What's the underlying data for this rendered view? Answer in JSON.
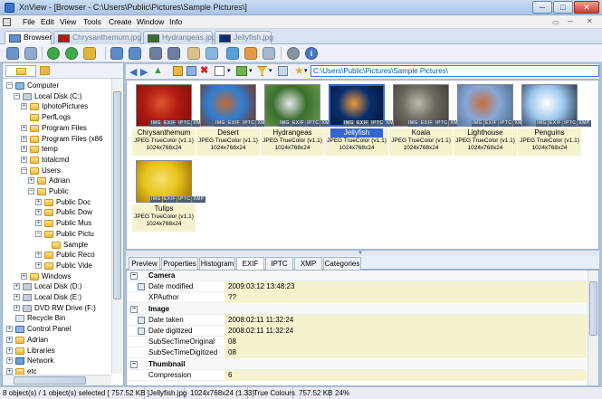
{
  "window": {
    "title": "XnView - [Browser - C:\\Users\\Public\\Pictures\\Sample Pictures\\]",
    "controls": [
      "─",
      "□",
      "✕"
    ]
  },
  "menu": [
    "File",
    "Edit",
    "View",
    "Tools",
    "Create",
    "Window",
    "Info"
  ],
  "tabs": [
    {
      "label": "Browser",
      "active": true
    },
    {
      "label": "Chrysanthemum.jpg",
      "active": false
    },
    {
      "label": "Hydrangeas.jpg",
      "active": false
    },
    {
      "label": "Jellyfish.jpg",
      "active": false
    }
  ],
  "path": "C:\\Users\\Public\\Pictures\\Sample Pictures\\",
  "tree": [
    {
      "label": "Computer",
      "icon": "computer-icon",
      "expander": "−"
    },
    {
      "label": "Local Disk (C:)",
      "icon": "drive-icon",
      "expander": "−"
    },
    {
      "label": "IphotoPictures",
      "icon": "folder-icon",
      "expander": "+"
    },
    {
      "label": "PerfLogs",
      "icon": "folder-icon",
      "expander": ""
    },
    {
      "label": "Program Files",
      "icon": "folder-icon",
      "expander": "+"
    },
    {
      "label": "Program Files (x86",
      "icon": "folder-icon",
      "expander": "+"
    },
    {
      "label": "temp",
      "icon": "folder-icon",
      "expander": "+"
    },
    {
      "label": "totalcmd",
      "icon": "folder-icon",
      "expander": "+"
    },
    {
      "label": "Users",
      "icon": "folder-icon",
      "expander": "−"
    },
    {
      "label": "Adrian",
      "icon": "folder-icon",
      "expander": "+"
    },
    {
      "label": "Public",
      "icon": "folder-icon",
      "expander": "−"
    },
    {
      "label": "Public Doc",
      "icon": "folder-icon",
      "expander": "+"
    },
    {
      "label": "Public Dow",
      "icon": "folder-icon",
      "expander": "+"
    },
    {
      "label": "Public Mus",
      "icon": "folder-icon",
      "expander": "+"
    },
    {
      "label": "Public Pictu",
      "icon": "folder-icon",
      "expander": "−"
    },
    {
      "label": "Sample",
      "icon": "folder-icon",
      "expander": ""
    },
    {
      "label": "Public Reco",
      "icon": "folder-icon",
      "expander": "+"
    },
    {
      "label": "Public Vide",
      "icon": "folder-icon",
      "expander": "+"
    },
    {
      "label": "Windows",
      "icon": "folder-icon",
      "expander": "+"
    },
    {
      "label": "Local Disk (D:)",
      "icon": "drive-icon",
      "expander": "+"
    },
    {
      "label": "Local Disk (E:)",
      "icon": "drive-icon",
      "expander": "+"
    },
    {
      "label": "DVD RW Drive (F:)",
      "icon": "drive-icon",
      "expander": "+"
    },
    {
      "label": "Recycle Bin",
      "icon": "bin-icon",
      "expander": ""
    },
    {
      "label": "Control Panel",
      "icon": "computer-icon",
      "expander": "+"
    },
    {
      "label": "Adrian",
      "icon": "folder-icon",
      "expander": "+"
    },
    {
      "label": "Libraries",
      "icon": "folder-icon",
      "expander": "+"
    },
    {
      "label": "Network",
      "icon": "network-icon",
      "expander": "+"
    },
    {
      "label": "etc",
      "icon": "folder-icon",
      "expander": "+"
    }
  ],
  "thumbnails": [
    {
      "name": "Chrysanthemum",
      "format": "JPEG TrueColor (v1.1)",
      "dims": "1024x768x24",
      "selected": false,
      "colors": [
        "#b21b12",
        "#e0552f",
        "#7a0d0b"
      ]
    },
    {
      "name": "Desert",
      "format": "JPEG TrueColor (v1.1)",
      "dims": "1024x768x24",
      "selected": false,
      "colors": [
        "#2d7fd6",
        "#c26a33",
        "#7a2f12"
      ]
    },
    {
      "name": "Hydrangeas",
      "format": "JPEG TrueColor (v1.1)",
      "dims": "1024x768x24",
      "selected": false,
      "colors": [
        "#3a6f2f",
        "#e8e9ef",
        "#6b9a4e"
      ]
    },
    {
      "name": "Jellyfish",
      "format": "JPEG TrueColor (v1.1)",
      "dims": "1024x768x24",
      "selected": true,
      "colors": [
        "#0a2f6e",
        "#ef9a39",
        "#02163a"
      ]
    },
    {
      "name": "Koala",
      "format": "JPEG TrueColor (v1.1)",
      "dims": "1024x768x24",
      "selected": false,
      "colors": [
        "#6d6a5f",
        "#bdb9ad",
        "#3f3b30"
      ]
    },
    {
      "name": "Lighthouse",
      "format": "JPEG TrueColor (v1.1)",
      "dims": "1024x768x24",
      "selected": false,
      "colors": [
        "#87a8d6",
        "#c96b3b",
        "#4b6b8f"
      ]
    },
    {
      "name": "Penguins",
      "format": "JPEG TrueColor (v1.1)",
      "dims": "1024x768x24",
      "selected": false,
      "colors": [
        "#9ec7ef",
        "#ffffff",
        "#1d2d45"
      ]
    },
    {
      "name": "Tulips",
      "format": "JPEG TrueColor (v1.1)",
      "dims": "1024x768x24",
      "selected": false,
      "colors": [
        "#e8c41c",
        "#f4e070",
        "#9a6a0a"
      ]
    }
  ],
  "thumb_badges": [
    "IMG",
    "EXIF",
    "IPTC",
    "XMP"
  ],
  "info_tabs": [
    "Preview",
    "Properties",
    "Histogram",
    "EXIF",
    "IPTC",
    "XMP",
    "Categories"
  ],
  "info_tab_active": "EXIF",
  "exif": [
    {
      "group": true,
      "key": "Camera",
      "mark": "−"
    },
    {
      "key": "Date modified",
      "value": "2009:03:12 13:48:23",
      "icon": true
    },
    {
      "key": "XPAuthor",
      "value": "??"
    },
    {
      "group": true,
      "key": "Image",
      "mark": "−"
    },
    {
      "key": "Date taken",
      "value": "2008:02:11 11:32:24",
      "icon": true
    },
    {
      "key": "Date digitized",
      "value": "2008:02:11 11:32:24",
      "icon": true
    },
    {
      "key": "SubSecTimeOriginal",
      "value": "08"
    },
    {
      "key": "SubSecTimeDigitized",
      "value": "08"
    },
    {
      "group": true,
      "key": "Thumbnail",
      "mark": "−"
    },
    {
      "key": "Compression",
      "value": "6"
    }
  ],
  "status": [
    "8 object(s) / 1 object(s) selected  [ 757.52 KB ]",
    "Jellyfish.jpg",
    "1024x768x24 (1.33)",
    "True Colours",
    "757.52 KB",
    "24%"
  ],
  "colors": {
    "accent": "#3366cc",
    "info_background": "#f5f2cf"
  }
}
